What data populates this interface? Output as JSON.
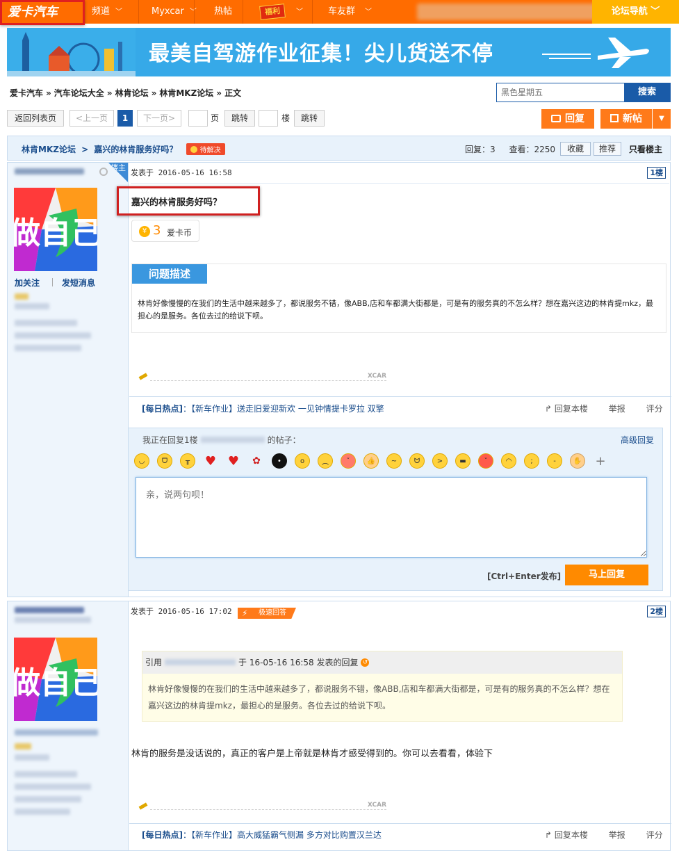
{
  "topnav": {
    "logo": "爱卡汽车",
    "items": [
      {
        "label": "频道",
        "chev": "﹀"
      },
      {
        "label": "Myxcar",
        "chev": "﹀"
      },
      {
        "label": "热帖",
        "chev": ""
      },
      {
        "label": "福利",
        "chev": "﹀"
      },
      {
        "label": "车友群",
        "chev": "﹀"
      }
    ],
    "forum_nav": "论坛导航 ﹀"
  },
  "banner": {
    "text": "最美自驾游作业征集！尖儿货送不停"
  },
  "breadcrumb": [
    "爱卡汽车",
    "汽车论坛大全",
    "林肯论坛",
    "林肯MKZ论坛",
    "正文"
  ],
  "breadcrumb_sep": "»",
  "search": {
    "placeholder": "黑色星期五",
    "button": "搜索"
  },
  "pager": {
    "back": "返回列表页",
    "prev": "<上一页",
    "current": "1",
    "next": "下一页>",
    "page_label": "页",
    "jump1": "跳转",
    "floor_label": "楼",
    "jump2": "跳转"
  },
  "post_buttons": {
    "reply": "回复",
    "new": "新帖"
  },
  "thread": {
    "forum": "林肯MKZ论坛",
    "sep": ">",
    "title": "嘉兴的林肯服务好吗？",
    "tag": "待解决",
    "replies_label": "回复：",
    "replies": "3",
    "views_label": "查看：",
    "views": "2250",
    "fav": "收藏",
    "recommend": "推荐",
    "only_op": "只看楼主"
  },
  "post1": {
    "op_badge": "楼主",
    "time": "发表于 2016-05-16 16:58",
    "floor": "1楼",
    "title": "嘉兴的林肯服务好吗？",
    "coin_amount": "3",
    "coin_label": "爱卡币",
    "desc_head": "问题描述",
    "desc": "林肯好像慢慢的在我们的生活中越来越多了，都说服务不错，像ABB,店和车都满大街都是，可是有的服务真的不怎么样？想在嘉兴这边的林肯提mkz，最担心的是服务。各位去过的给说下呗。",
    "follow": "加关注",
    "message": "发短消息",
    "hot_label": "[每日热点]",
    "hot_text": "【新车作业】送走旧爱迎新欢 一见钟情提卡罗拉 双擎",
    "reply_this": "回复本楼",
    "report": "举报",
    "rate": "评分"
  },
  "replybox": {
    "replying_prefix": "我正在回复1楼",
    "replying_suffix": "的帖子：",
    "advanced": "高级回复",
    "placeholder": "亲，说两句呗！",
    "shortcut": "[Ctrl+Enter发布]",
    "send": "马上回复"
  },
  "post2": {
    "time": "发表于 2016-05-16 17:02",
    "fast_tag": "极速回答",
    "floor": "2楼",
    "quote_prefix": "引用",
    "quote_suffix": "于 16-05-16 16:58 发表的回复",
    "quote_text": "林肯好像慢慢的在我们的生活中越来越多了，都说服务不错，像ABB,店和车都满大街都是，可是有的服务真的不怎么样？想在嘉兴这边的林肯提mkz，最担心的是服务。各位去过的给说下呗。",
    "text": "林肯的服务是没话说的，真正的客户是上帝就是林肯才感受得到的。你可以去看看，体验下",
    "hot_label": "[每日热点]",
    "hot_text": "【新车作业】高大威猛霸气侧漏 多方对比购置汉兰达",
    "reply_this": "回复本楼",
    "report": "举报",
    "rate": "评分"
  },
  "sig_mark": "XCAR",
  "colors": {
    "accent": "#ff6c00",
    "link": "#1a4d8c",
    "search": "#1a5ba8"
  }
}
